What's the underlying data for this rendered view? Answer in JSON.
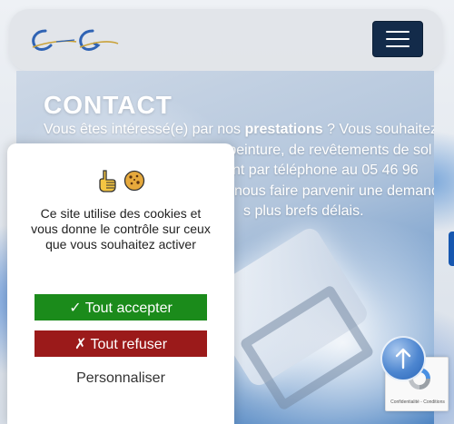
{
  "header": {
    "logo_icon": "brand-logo",
    "menu_icon": "hamburger-icon"
  },
  "hero": {
    "title": "CONTACT",
    "text_part1": "Vous êtes intéressé(e) par nos ",
    "text_bold": "prestations",
    "text_part2": " ? Vous souhaitez ",
    "line2_start": "",
    "line2_mid": "e peinture, de revêtements de sol",
    "line3": "nt par téléphone au 05 46 96",
    "line4": "nous faire parvenir une demande",
    "line5": "s plus brefs délais."
  },
  "cookie": {
    "icons": [
      "pointing-hand-icon",
      "cookie-icon"
    ],
    "message": "Ce site utilise des cookies et vous donne le contrôle sur ceux que vous souhaitez activer",
    "accept_label": "✓ Tout accepter",
    "refuse_label": "✗ Tout refuser",
    "customize_label": "Personnaliser"
  },
  "recaptcha": {
    "links": "Confidentialité - Conditions"
  },
  "colors": {
    "menu_button": "#132b4a",
    "accept": "#1b8b1b",
    "refuse": "#9b1a1a",
    "accent_blue": "#1657b0"
  }
}
